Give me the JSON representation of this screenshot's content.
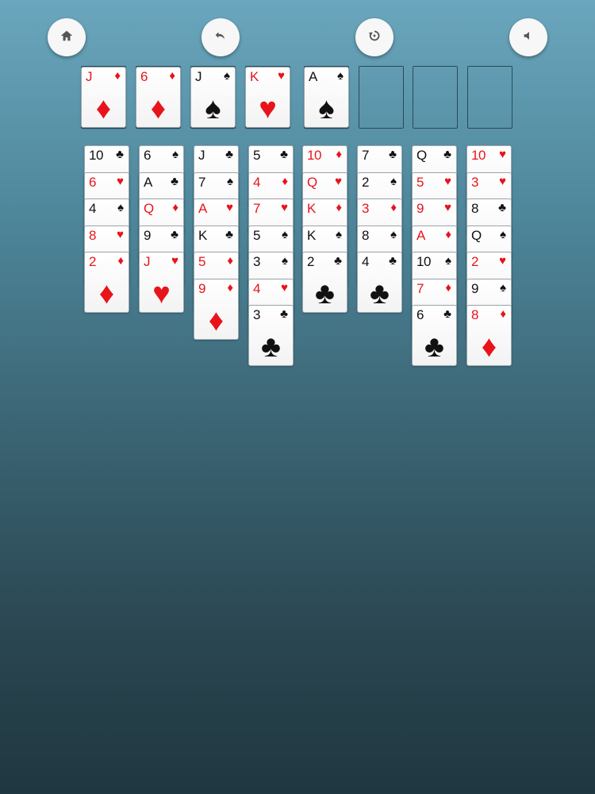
{
  "toolbar": {
    "home": "home-icon",
    "undo": "undo-icon",
    "restart": "restart-icon",
    "sound": "sound-icon"
  },
  "colors": {
    "red": "#e8141b",
    "black": "#111111"
  },
  "free_cells": [
    {
      "rank": "J",
      "suit": "♦",
      "color": "red"
    },
    {
      "rank": "6",
      "suit": "♦",
      "color": "red"
    },
    {
      "rank": "J",
      "suit": "♠",
      "color": "black"
    },
    {
      "rank": "K",
      "suit": "♥",
      "color": "red"
    },
    {
      "rank": "A",
      "suit": "♠",
      "color": "black"
    },
    null,
    null,
    null
  ],
  "tableau": [
    [
      {
        "rank": "10",
        "suit": "♣",
        "color": "black"
      },
      {
        "rank": "6",
        "suit": "♥",
        "color": "red"
      },
      {
        "rank": "4",
        "suit": "♠",
        "color": "black"
      },
      {
        "rank": "8",
        "suit": "♥",
        "color": "red"
      },
      {
        "rank": "2",
        "suit": "♦",
        "color": "red"
      }
    ],
    [
      {
        "rank": "6",
        "suit": "♠",
        "color": "black"
      },
      {
        "rank": "A",
        "suit": "♣",
        "color": "black"
      },
      {
        "rank": "Q",
        "suit": "♦",
        "color": "red"
      },
      {
        "rank": "9",
        "suit": "♣",
        "color": "black"
      },
      {
        "rank": "J",
        "suit": "♥",
        "color": "red"
      }
    ],
    [
      {
        "rank": "J",
        "suit": "♣",
        "color": "black"
      },
      {
        "rank": "7",
        "suit": "♠",
        "color": "black"
      },
      {
        "rank": "A",
        "suit": "♥",
        "color": "red"
      },
      {
        "rank": "K",
        "suit": "♣",
        "color": "black"
      },
      {
        "rank": "5",
        "suit": "♦",
        "color": "red"
      },
      {
        "rank": "9",
        "suit": "♦",
        "color": "red"
      }
    ],
    [
      {
        "rank": "5",
        "suit": "♣",
        "color": "black"
      },
      {
        "rank": "4",
        "suit": "♦",
        "color": "red"
      },
      {
        "rank": "7",
        "suit": "♥",
        "color": "red"
      },
      {
        "rank": "5",
        "suit": "♠",
        "color": "black"
      },
      {
        "rank": "3",
        "suit": "♠",
        "color": "black"
      },
      {
        "rank": "4",
        "suit": "♥",
        "color": "red"
      },
      {
        "rank": "3",
        "suit": "♣",
        "color": "black"
      }
    ],
    [
      {
        "rank": "10",
        "suit": "♦",
        "color": "red"
      },
      {
        "rank": "Q",
        "suit": "♥",
        "color": "red"
      },
      {
        "rank": "K",
        "suit": "♦",
        "color": "red"
      },
      {
        "rank": "K",
        "suit": "♠",
        "color": "black"
      },
      {
        "rank": "2",
        "suit": "♣",
        "color": "black"
      }
    ],
    [
      {
        "rank": "7",
        "suit": "♣",
        "color": "black"
      },
      {
        "rank": "2",
        "suit": "♠",
        "color": "black"
      },
      {
        "rank": "3",
        "suit": "♦",
        "color": "red"
      },
      {
        "rank": "8",
        "suit": "♠",
        "color": "black"
      },
      {
        "rank": "4",
        "suit": "♣",
        "color": "black"
      }
    ],
    [
      {
        "rank": "Q",
        "suit": "♣",
        "color": "black"
      },
      {
        "rank": "5",
        "suit": "♥",
        "color": "red"
      },
      {
        "rank": "9",
        "suit": "♥",
        "color": "red"
      },
      {
        "rank": "A",
        "suit": "♦",
        "color": "red"
      },
      {
        "rank": "10",
        "suit": "♠",
        "color": "black"
      },
      {
        "rank": "7",
        "suit": "♦",
        "color": "red"
      },
      {
        "rank": "6",
        "suit": "♣",
        "color": "black"
      }
    ],
    [
      {
        "rank": "10",
        "suit": "♥",
        "color": "red"
      },
      {
        "rank": "3",
        "suit": "♥",
        "color": "red"
      },
      {
        "rank": "8",
        "suit": "♣",
        "color": "black"
      },
      {
        "rank": "Q",
        "suit": "♠",
        "color": "black"
      },
      {
        "rank": "2",
        "suit": "♥",
        "color": "red"
      },
      {
        "rank": "9",
        "suit": "♠",
        "color": "black"
      },
      {
        "rank": "8",
        "suit": "♦",
        "color": "red"
      }
    ]
  ]
}
